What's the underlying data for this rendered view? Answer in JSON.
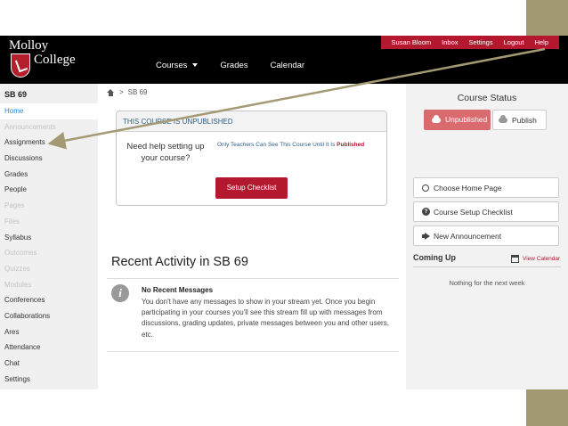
{
  "top_bar": {
    "logo_line1": "Molloy",
    "logo_line2": "College",
    "user_menu": [
      "Susan Bloom",
      "Inbox",
      "Settings",
      "Logout",
      "Help"
    ],
    "main_nav": [
      "Courses",
      "Grades",
      "Calendar"
    ]
  },
  "sidebar": {
    "course_code": "SB 69",
    "items": [
      {
        "label": "Home",
        "state": "active"
      },
      {
        "label": "Announcements",
        "state": "disabled"
      },
      {
        "label": "Assignments",
        "state": "normal"
      },
      {
        "label": "Discussions",
        "state": "normal"
      },
      {
        "label": "Grades",
        "state": "normal"
      },
      {
        "label": "People",
        "state": "normal"
      },
      {
        "label": "Pages",
        "state": "disabled"
      },
      {
        "label": "Files",
        "state": "disabled"
      },
      {
        "label": "Syllabus",
        "state": "normal"
      },
      {
        "label": "Outcomes",
        "state": "disabled"
      },
      {
        "label": "Quizzes",
        "state": "disabled"
      },
      {
        "label": "Modules",
        "state": "disabled"
      },
      {
        "label": "Conferences",
        "state": "normal"
      },
      {
        "label": "Collaborations",
        "state": "normal"
      },
      {
        "label": "Ares",
        "state": "normal"
      },
      {
        "label": "Attendance",
        "state": "normal"
      },
      {
        "label": "Chat",
        "state": "normal"
      },
      {
        "label": "Settings",
        "state": "normal"
      }
    ]
  },
  "breadcrumb": {
    "separator": ">",
    "current": "SB 69"
  },
  "unpublished_notice": {
    "header": "THIS COURSE IS UNPUBLISHED",
    "help_line1": "Need help setting up",
    "help_line2": "your course?",
    "note_prefix": "Only Teachers Can See This Course Until It Is",
    "note_highlight": "Published",
    "button": "Setup Checklist"
  },
  "recent_activity": {
    "title": "Recent Activity in SB 69",
    "empty_title": "No Recent Messages",
    "empty_body": "You don't have any messages to show in your stream yet. Once you begin participating in your courses you'll see this stream fill up with messages from discussions, grading updates, private messages between you and other users, etc."
  },
  "course_status": {
    "title": "Course Status",
    "unpublished_label": "Unpublished",
    "publish_label": "Publish"
  },
  "actions": [
    {
      "label": "Choose Home Page",
      "icon": "circle-o-icon"
    },
    {
      "label": "Course Setup Checklist",
      "icon": "question-circle-icon"
    },
    {
      "label": "New Announcement",
      "icon": "megaphone-icon"
    }
  ],
  "coming_up": {
    "title": "Coming Up",
    "view_calendar": "View Calendar",
    "empty": "Nothing for the next week"
  },
  "colors": {
    "brand_red": "#b3182f",
    "unpublished_bg": "#d96a6e",
    "link_blue": "#2a8ad8",
    "slide_accent": "#a39a74"
  }
}
